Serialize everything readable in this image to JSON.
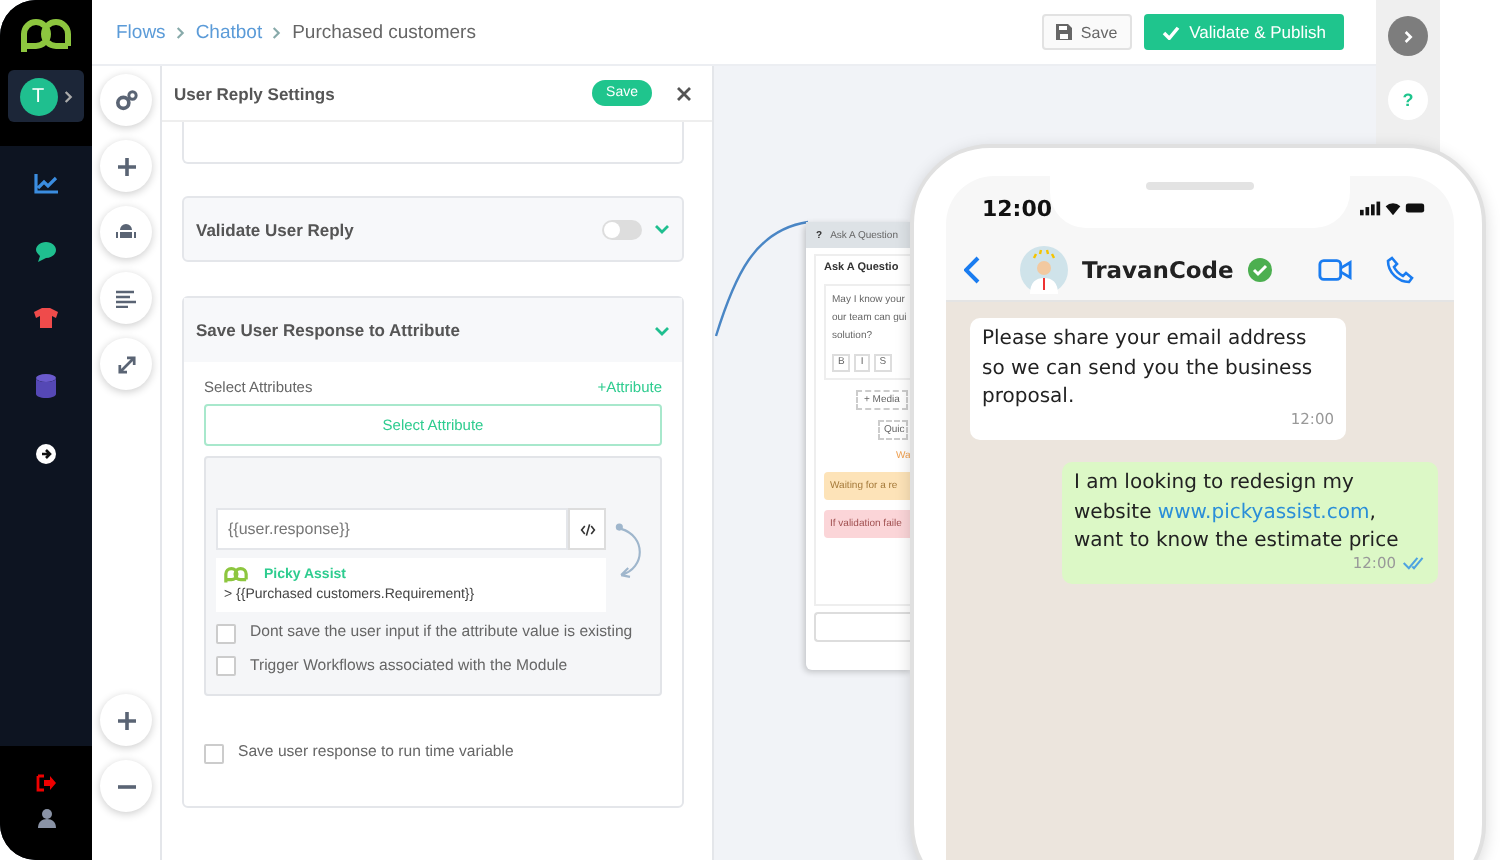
{
  "breadcrumb": [
    {
      "label": "Flows",
      "link": true
    },
    {
      "label": "Chatbot",
      "link": true
    },
    {
      "label": "Purchased customers",
      "link": false
    }
  ],
  "toolbar": {
    "save": "Save",
    "publish": "Validate & Publish"
  },
  "sidebar": {
    "avatar": "T"
  },
  "rail": {
    "help": "?"
  },
  "panel": {
    "title": "User Reply Settings",
    "save": "Save",
    "validate": {
      "title": "Validate User Reply",
      "on": false,
      "expanded": false
    },
    "attribute_section": {
      "title": "Save User Response to Attribute",
      "expanded": true,
      "select_label": "Select Attributes",
      "add_link": "+Attribute",
      "select_button": "Select Attribute",
      "response_value": "{{user.response}}",
      "mapping_source": "Picky Assist",
      "mapping_target": "> {{Purchased customers.Requirement}}",
      "options": [
        {
          "label": "Dont save the user input if the attribute value is existing",
          "checked": false
        },
        {
          "label": "Trigger Workflows associated with the Module",
          "checked": false
        }
      ]
    },
    "runtime_option": {
      "label": "Save user response to run time variable",
      "checked": false
    }
  },
  "node": {
    "icon": "?",
    "header": "Ask A Question",
    "title": "Ask A Questio",
    "body": [
      "May I know your",
      "our team can gui",
      "solution?"
    ],
    "format_buttons": [
      "B",
      "I",
      "S"
    ],
    "media_button": "+ Media",
    "quick_button": "Quic",
    "warning": "Wa",
    "waiting": "Waiting for a re",
    "validation": "If validation faile"
  },
  "phone": {
    "time": "12:00",
    "contact": "TravanCode",
    "messages": [
      {
        "kind": "received",
        "text": "Please share your email address so we can send you the business proposal.",
        "time": "12:00"
      },
      {
        "kind": "sent",
        "text_before": "I am looking to redesign my website ",
        "link": "www.pickyassist.com",
        "text_after": ", want to know the estimate price",
        "time": "12:00",
        "read": true
      }
    ]
  }
}
